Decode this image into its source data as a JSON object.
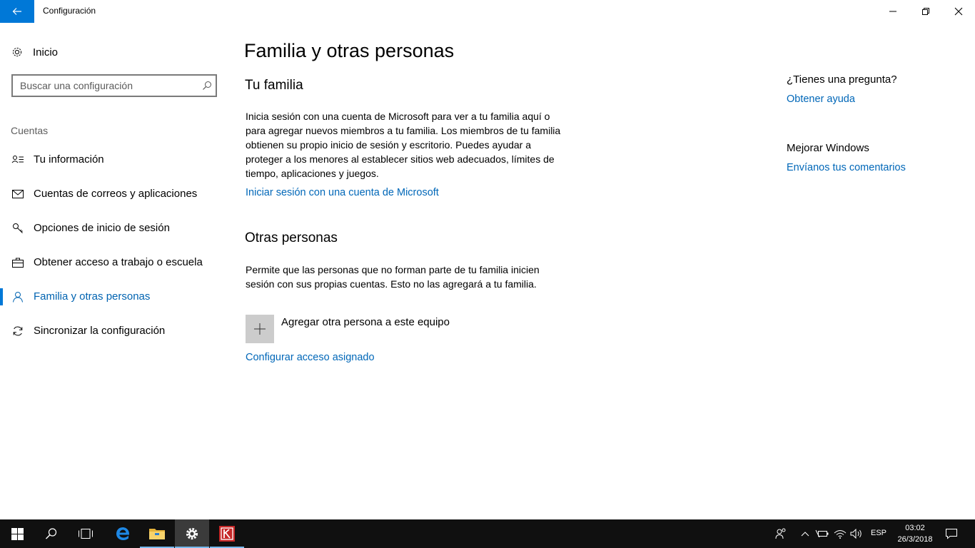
{
  "window": {
    "title": "Configuración"
  },
  "sidebar": {
    "home_label": "Inicio",
    "search_placeholder": "Buscar una configuración",
    "section_header": "Cuentas",
    "items": [
      {
        "label": "Tu información",
        "icon": "person-card-icon"
      },
      {
        "label": "Cuentas de correos y aplicaciones",
        "icon": "mail-icon"
      },
      {
        "label": "Opciones de inicio de sesión",
        "icon": "key-icon"
      },
      {
        "label": "Obtener acceso a trabajo o escuela",
        "icon": "briefcase-icon"
      },
      {
        "label": "Familia y otras personas",
        "icon": "person-icon",
        "active": true
      },
      {
        "label": "Sincronizar la configuración",
        "icon": "sync-icon"
      }
    ]
  },
  "main": {
    "title": "Familia y otras personas",
    "family": {
      "heading": "Tu familia",
      "description": "Inicia sesión con una cuenta de Microsoft para ver a tu familia aquí o para agregar nuevos miembros a tu familia. Los miembros de tu familia obtienen su propio inicio de sesión y escritorio. Puedes ayudar a proteger a los menores al establecer sitios web adecuados, límites de tiempo, aplicaciones y juegos.",
      "signin_link": "Iniciar sesión con una cuenta de Microsoft"
    },
    "others": {
      "heading": "Otras personas",
      "description": "Permite que las personas que no forman parte de tu familia inicien sesión con sus propias cuentas. Esto no las agregará a tu familia.",
      "add_label": "Agregar otra persona a este equipo",
      "assigned_access_link": "Configurar acceso asignado"
    }
  },
  "right": {
    "question_heading": "¿Tienes una pregunta?",
    "help_link": "Obtener ayuda",
    "improve_heading": "Mejorar Windows",
    "feedback_link": "Envíanos tus comentarios"
  },
  "taskbar": {
    "language": "ESP",
    "time": "03:02",
    "date": "26/3/2018"
  },
  "colors": {
    "accent": "#0078d7",
    "link": "#0067b8",
    "taskbar": "#101010"
  }
}
